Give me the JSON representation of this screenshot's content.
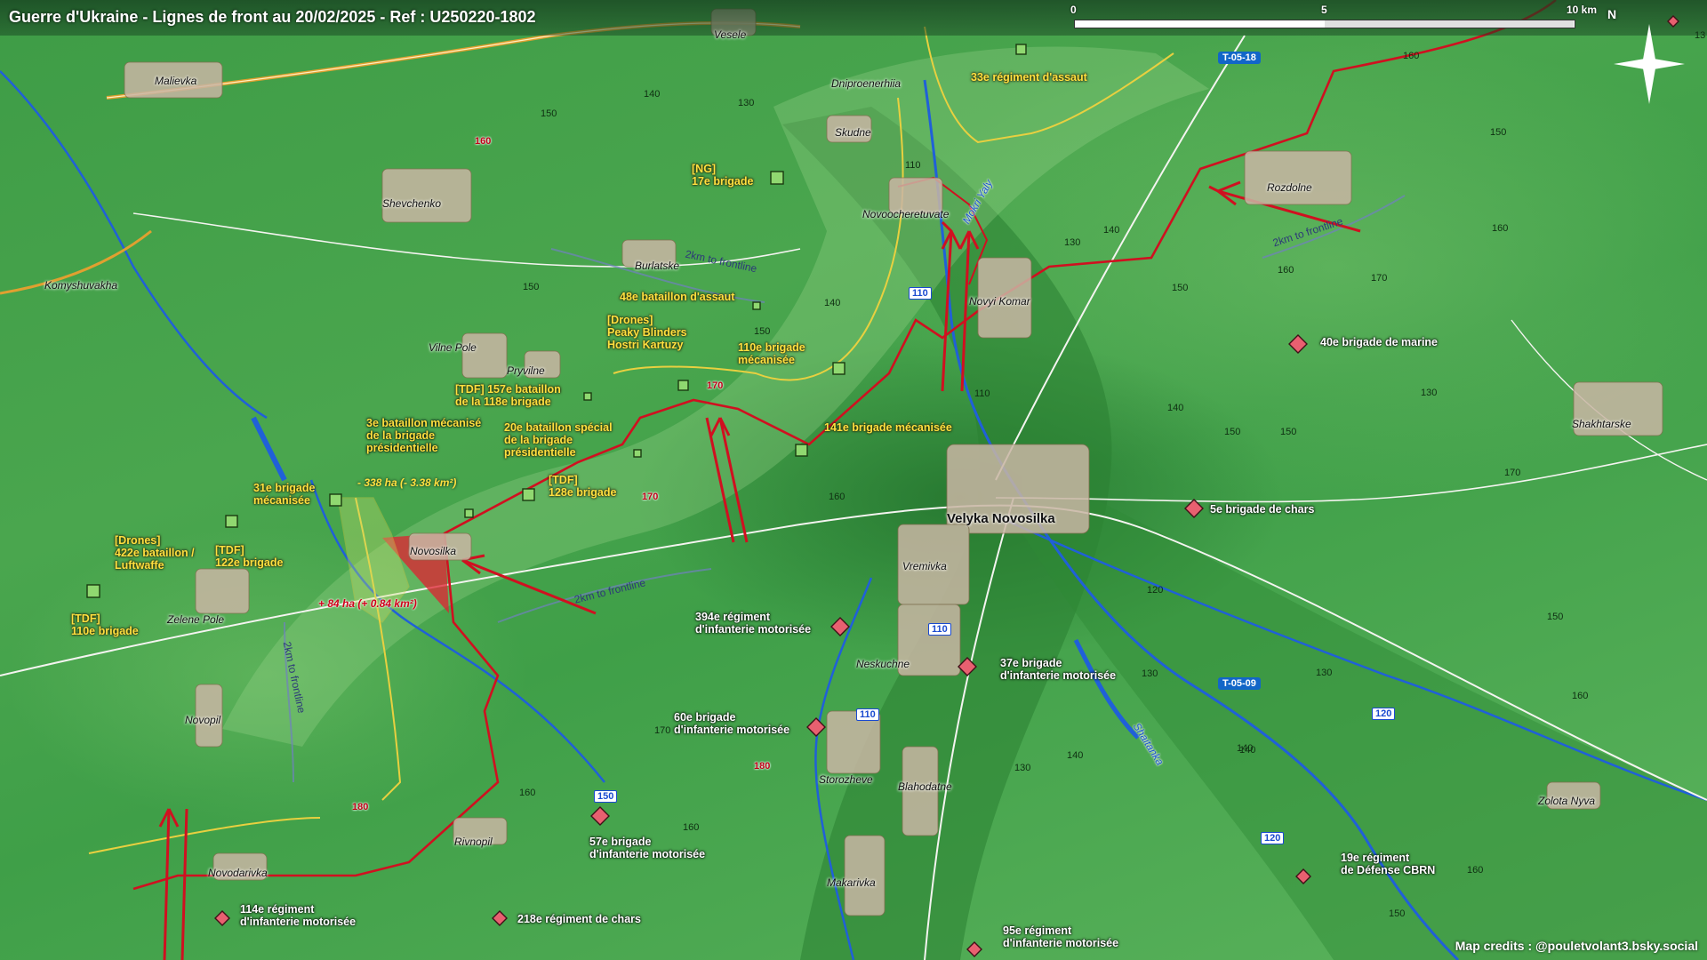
{
  "header": {
    "title": "Guerre d'Ukraine - Lignes de front au 20/02/2025 - Ref : U250220-1802",
    "scale": {
      "labels": [
        "0",
        "5",
        "10 km"
      ]
    },
    "north": "N"
  },
  "towns": [
    {
      "name": "Vesele",
      "key": "vesele"
    },
    {
      "name": "Malievka",
      "key": "malievka"
    },
    {
      "name": "Dniproenerhiia",
      "key": "dniproenerhiia"
    },
    {
      "name": "Skudne",
      "key": "skudne"
    },
    {
      "name": "Shevchenko",
      "key": "shevchenko"
    },
    {
      "name": "Novoocheretuvate",
      "key": "novoocheretuvate"
    },
    {
      "name": "Rozdolne",
      "key": "rozdolne"
    },
    {
      "name": "Burlatske",
      "key": "burlatske"
    },
    {
      "name": "Komyshuvakha",
      "key": "komyshuvakha"
    },
    {
      "name": "Novyi Komar",
      "key": "novyi_komar"
    },
    {
      "name": "Vilne Pole",
      "key": "vilne_pole"
    },
    {
      "name": "Pryvilne",
      "key": "pryvilne"
    },
    {
      "name": "Shakhtarske",
      "key": "shakhtarske"
    },
    {
      "name": "Velyka Novosilka",
      "key": "velyka_novosilka"
    },
    {
      "name": "Novosilka",
      "key": "novosilka"
    },
    {
      "name": "Vremivka",
      "key": "vremivka"
    },
    {
      "name": "Zelene Pole",
      "key": "zelene_pole"
    },
    {
      "name": "Neskuchne",
      "key": "neskuchne"
    },
    {
      "name": "Novopil",
      "key": "novopil"
    },
    {
      "name": "Storozheve",
      "key": "storozheve"
    },
    {
      "name": "Blahodatne",
      "key": "blahodatne"
    },
    {
      "name": "Zolota Nyva",
      "key": "zolota_nyva"
    },
    {
      "name": "Rivnopil",
      "key": "rivnopil"
    },
    {
      "name": "Novodarivka",
      "key": "novodarivka"
    },
    {
      "name": "Makarivka",
      "key": "makarivka"
    }
  ],
  "units_ua": [
    {
      "key": "ua_33",
      "lines": [
        "33e régiment d'assaut"
      ]
    },
    {
      "key": "ua_17",
      "lines": [
        "[NG]",
        "17e brigade"
      ]
    },
    {
      "key": "ua_48",
      "lines": [
        "48e bataillon d'assaut"
      ]
    },
    {
      "key": "ua_drones_pb",
      "lines": [
        "[Drones]",
        "Peaky Blinders",
        "Hostri Kartuzy"
      ]
    },
    {
      "key": "ua_110m",
      "lines": [
        "110e brigade",
        "mécanisée"
      ]
    },
    {
      "key": "ua_157",
      "lines": [
        "[TDF] 157e bataillon",
        "de la 118e brigade"
      ]
    },
    {
      "key": "ua_3pres",
      "lines": [
        "3e bataillon mécanisé",
        "de la brigade",
        "présidentielle"
      ]
    },
    {
      "key": "ua_20pres",
      "lines": [
        "20e bataillon spécial",
        "de la brigade",
        "présidentielle"
      ]
    },
    {
      "key": "ua_141",
      "lines": [
        "141e brigade mécanisée"
      ]
    },
    {
      "key": "ua_128",
      "lines": [
        "[TDF]",
        "128e brigade"
      ]
    },
    {
      "key": "ua_31",
      "lines": [
        "31e brigade",
        "mécanisée"
      ]
    },
    {
      "key": "ua_422",
      "lines": [
        "[Drones]",
        "422e bataillon /",
        "Luftwaffe"
      ]
    },
    {
      "key": "ua_122",
      "lines": [
        "[TDF]",
        "122e brigade"
      ]
    },
    {
      "key": "ua_110tdf",
      "lines": [
        "[TDF]",
        "110e brigade"
      ]
    }
  ],
  "units_ru": [
    {
      "key": "ru_40",
      "lines": [
        "40e brigade de marine"
      ]
    },
    {
      "key": "ru_5",
      "lines": [
        "5e brigade de chars"
      ]
    },
    {
      "key": "ru_394",
      "lines": [
        "394e régiment",
        "d'infanterie motorisée"
      ]
    },
    {
      "key": "ru_37",
      "lines": [
        "37e brigade",
        "d'infanterie motorisée"
      ]
    },
    {
      "key": "ru_60",
      "lines": [
        "60e brigade",
        "d'infanterie motorisée"
      ]
    },
    {
      "key": "ru_57",
      "lines": [
        "57e brigade",
        "d'infanterie motorisée"
      ]
    },
    {
      "key": "ru_19",
      "lines": [
        "19e régiment",
        "de Défense CBRN"
      ]
    },
    {
      "key": "ru_114",
      "lines": [
        "114e régiment",
        "d'infanterie motorisée"
      ]
    },
    {
      "key": "ru_218",
      "lines": [
        "218e régiment de chars"
      ]
    },
    {
      "key": "ru_95",
      "lines": [
        "95e régiment",
        "d'infanterie motorisée"
      ]
    }
  ],
  "roads": {
    "t0518": "T-05-18",
    "t0509": "T-05-09"
  },
  "road_numbers": [
    "110",
    "110",
    "110",
    "150",
    "120",
    "120"
  ],
  "rivers": {
    "mokri_yaly": "Mokri Yaly",
    "shaitanka": "Shaitanka"
  },
  "frontline_labels": [
    "2km to frontline",
    "2km to frontline",
    "2km to frontline",
    "2km to frontline"
  ],
  "areas": {
    "loss": "- 338 ha (- 3.38 km²)",
    "gain": "+ 84 ha (+ 0.84 km²)"
  },
  "altitudes": {
    "black": [
      "150",
      "140",
      "130",
      "150",
      "110",
      "130",
      "140",
      "160",
      "150",
      "140",
      "150",
      "150",
      "160",
      "160",
      "170",
      "110",
      "140",
      "150",
      "170",
      "160",
      "130",
      "130",
      "140",
      "140",
      "170",
      "130",
      "160",
      "160",
      "150",
      "150",
      "120",
      "160",
      "160",
      "150",
      "140",
      "130"
    ],
    "red": [
      "160",
      "170",
      "170",
      "180",
      "180"
    ]
  },
  "credits": "Map credits : @pouletvolant3.bsky.social",
  "corner_code": "13",
  "colors": {
    "ukraine_units": "#ffe040",
    "russia_units": "#e05868",
    "front": "#d01020",
    "road_badge": "#1266c8"
  }
}
